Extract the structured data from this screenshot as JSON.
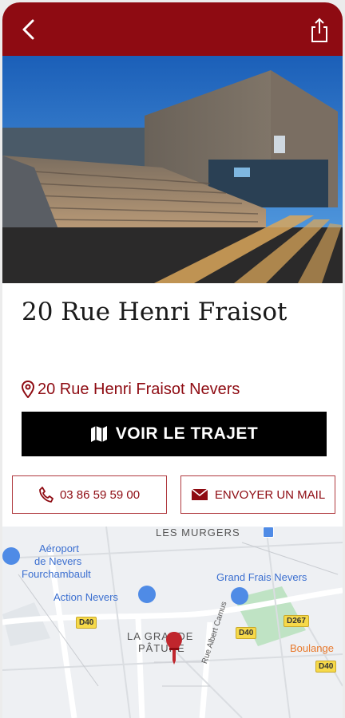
{
  "header": {
    "back_icon": "chevron-left-icon",
    "share_icon": "share-icon",
    "color": "#8e0b12"
  },
  "place": {
    "title": "20 Rue Henri Fraisot",
    "address": "20 Rue Henri Fraisot Nevers"
  },
  "actions": {
    "route_label": "VOIR LE TRAJET",
    "phone_label": "03 86 59 59 00",
    "mail_label": "ENVOYER UN MAIL"
  },
  "map": {
    "labels": {
      "murgers": "LES MURGERS",
      "airport_1": "Aéroport",
      "airport_2": "de Nevers",
      "airport_3": "Fourchambault",
      "grand_frais": "Grand Frais Nevers",
      "action": "Action Nevers",
      "grande_1": "LA GRANDE",
      "grande_2": "PÂTURE",
      "boulange": "Boulange",
      "street": "Rue Albert Camus",
      "d40_a": "D40",
      "d40_b": "D40",
      "d40_c": "D40",
      "d267": "D267"
    }
  }
}
